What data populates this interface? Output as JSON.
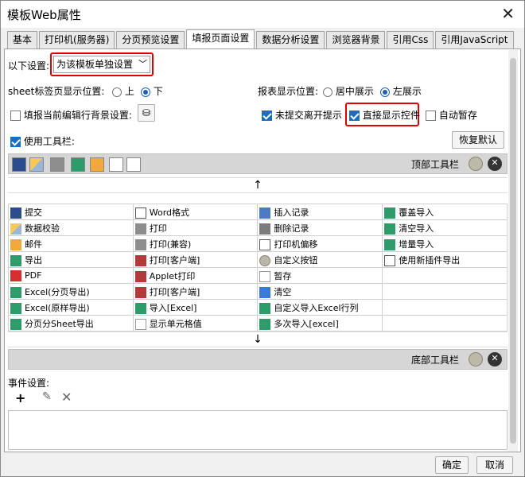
{
  "window": {
    "title": "模板Web属性"
  },
  "tabs": [
    {
      "label": "基本"
    },
    {
      "label": "打印机(服务器)"
    },
    {
      "label": "分页预览设置"
    },
    {
      "label": "填报页面设置"
    },
    {
      "label": "数据分析设置"
    },
    {
      "label": "浏览器背景"
    },
    {
      "label": "引用Css"
    },
    {
      "label": "引用JavaScript"
    }
  ],
  "settings": {
    "below_label": "以下设置:",
    "mode_value": "为该模板单独设置",
    "sheet_tab_label": "sheet标签页显示位置:",
    "sheet_opts": [
      "上",
      "下"
    ],
    "report_pos_label": "报表显示位置:",
    "report_opts": [
      "居中展示",
      "左展示"
    ],
    "fill_bg_label": "填报当前编辑行背景设置:",
    "unsubmitted_label": "未提交离开提示",
    "direct_control_label": "直接显示控件",
    "autosave_label": "自动暂存",
    "toolbar_label": "使用工具栏:",
    "restore_label": "恢复默认"
  },
  "toolbar": {
    "top_label": "顶部工具栏",
    "bottom_label": "底部工具栏"
  },
  "grid": [
    [
      "提交",
      "Word格式",
      "插入记录",
      "覆盖导入"
    ],
    [
      "数据校验",
      "打印",
      "删除记录",
      "清空导入"
    ],
    [
      "邮件",
      "打印(兼容)",
      "打印机偏移",
      "增量导入"
    ],
    [
      "导出",
      "打印[客户端]",
      "自定义按钮",
      "使用新插件导出"
    ],
    [
      "PDF",
      "Applet打印",
      "暂存",
      ""
    ],
    [
      "Excel(分页导出)",
      "打印[客户端]",
      "清空",
      ""
    ],
    [
      "Excel(原样导出)",
      "导入[Excel]",
      "自定义导入Excel行列",
      ""
    ],
    [
      "分页分Sheet导出",
      "显示单元格值",
      "多次导入[excel]",
      ""
    ]
  ],
  "events": {
    "label": "事件设置:"
  },
  "footer": {
    "ok": "确定",
    "cancel": "取消"
  }
}
